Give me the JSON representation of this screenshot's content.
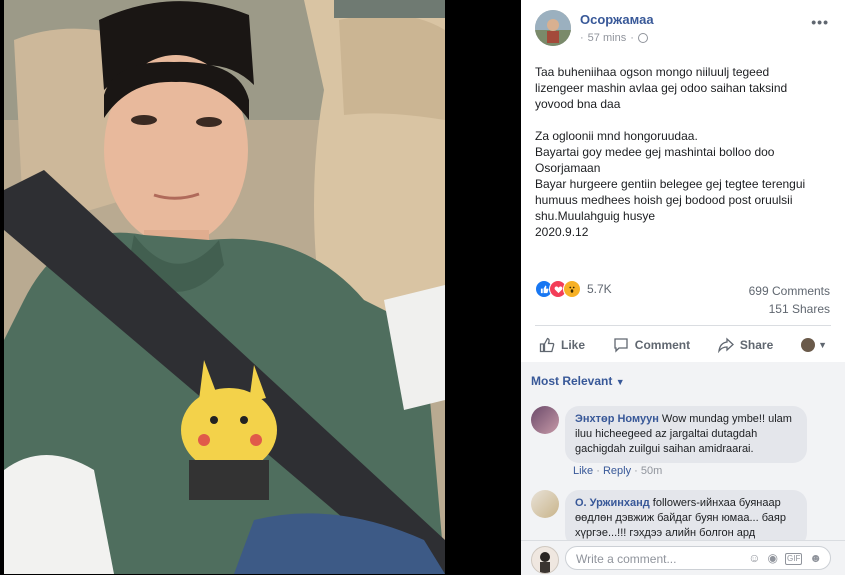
{
  "post": {
    "author": "Осоржамаа",
    "time": "57 mins",
    "separator": "·",
    "more": "•••",
    "text": "Taa buheniihaa ogson mongo niiluulj tegeed lizengeer mashin avlaa gej odoo saihan taksind yovood bna daa\n\nZa ogloonii mnd hongoruudaa.\nBayartai goy medee gej mashintai bolloo doo Osorjamaan\nBayar hurgeere gentiin belegee gej tegtee terengui humuus medhees hoish gej bodood post oruulsii shu.Muulahguig husye\n2020.9.12"
  },
  "reactions": {
    "count": "5.7K",
    "comments": "699 Comments",
    "shares": "151 Shares"
  },
  "actions": {
    "like": "Like",
    "comment": "Comment",
    "share": "Share"
  },
  "comments_section": {
    "sort_label": "Most Relevant",
    "items": [
      {
        "name": "Энхтөр Номуун",
        "text": "Wow mundag ymbe!! ulam iluu hicheegeed az jargaltai dutagdah gachigdah zuilgui saihan amidraarai.",
        "like": "Like",
        "reply": "Reply",
        "time": "50m"
      },
      {
        "name": "О. Уржинханд",
        "text": "followers-ийнхаа буянаар өөдлөн дэвжиж байдаг буян юмаа... баяр хүргэе...!!! гэхдээ алийн болгон ард"
      }
    ],
    "composer_placeholder": "Write a comment..."
  },
  "colors": {
    "link": "#385898",
    "like_blue": "#1877f2",
    "love_red": "#f33e58",
    "wow_yellow": "#f7b125"
  }
}
